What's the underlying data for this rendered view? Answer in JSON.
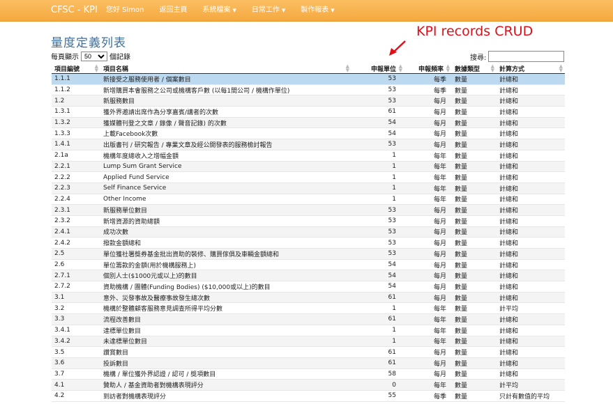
{
  "navbar": {
    "brand": "CFSC - KPI",
    "items": [
      {
        "label": "您好 Simon",
        "caret": false
      },
      {
        "label": "返回主頁",
        "caret": false
      },
      {
        "label": "系統檔案",
        "caret": true
      },
      {
        "label": "日常工作",
        "caret": true
      },
      {
        "label": "製作報表",
        "caret": true
      }
    ]
  },
  "page_title": "量度定義列表",
  "annotation": "KPI records CRUD",
  "length": {
    "before": "每頁顯示",
    "value": "50",
    "after": "個記錄"
  },
  "search": {
    "label": "搜尋:",
    "value": ""
  },
  "columns": [
    "項目編號",
    "項目名稱",
    "申報單位",
    "申報頻率",
    "數據類型",
    "計算方式"
  ],
  "rows": [
    [
      "1.1.1",
      "新接受之服務使用者 / 個案數目",
      "53",
      "每季",
      "數量",
      "計總和"
    ],
    [
      "1.1.2",
      "新增購買本會服務之公司或機構客戶數 (以每1間公司 / 機構作單位)",
      "53",
      "每季",
      "數量",
      "計總和"
    ],
    [
      "1.2",
      "新服務數目",
      "53",
      "每月",
      "數量",
      "計總和"
    ],
    [
      "1.3.1",
      "獲外界邀請出席作為分享嘉賓/講者的次數",
      "61",
      "每月",
      "數量",
      "計總和"
    ],
    [
      "1.3.2",
      "獲媒體刊登之文章 / 錄像 / 聲音記錄) 的次數",
      "54",
      "每月",
      "數量",
      "計總和"
    ],
    [
      "1.3.3",
      "上載Facebook次數",
      "54",
      "每月",
      "數量",
      "計總和"
    ],
    [
      "1.4.1",
      "出版書刊 / 研究報告 / 專業文章及經公開發表的服務檢討報告",
      "53",
      "每月",
      "數量",
      "計總和"
    ],
    [
      "2.1a",
      "機構年度總收入之增幅金額",
      "1",
      "每年",
      "數量",
      "計總和"
    ],
    [
      "2.2.1",
      "Lump Sum Grant Service",
      "1",
      "每年",
      "數量",
      "計總和"
    ],
    [
      "2.2.2",
      "Applied Fund Service",
      "1",
      "每年",
      "數量",
      "計總和"
    ],
    [
      "2.2.3",
      "Self Finance Service",
      "1",
      "每年",
      "數量",
      "計總和"
    ],
    [
      "2.2.4",
      "Other Income",
      "1",
      "每年",
      "數量",
      "計總和"
    ],
    [
      "2.3.1",
      "新服務單位數目",
      "53",
      "每月",
      "數量",
      "計總和"
    ],
    [
      "2.3.2",
      "新增資源的資助總額",
      "53",
      "每月",
      "數量",
      "計總和"
    ],
    [
      "2.4.1",
      "成功次數",
      "53",
      "每月",
      "數量",
      "計總和"
    ],
    [
      "2.4.2",
      "撥款金額總和",
      "53",
      "每月",
      "數量",
      "計總和"
    ],
    [
      "2.5",
      "單位獲社署獎券基金批出資助的裝修、購買傢俱及車輛金額總和",
      "53",
      "每月",
      "數量",
      "計總和"
    ],
    [
      "2.6",
      "單位籌款的金額(用於機構服務上)",
      "54",
      "每月",
      "數量",
      "計總和"
    ],
    [
      "2.7.1",
      "個別人士($1000元或以上)的數目",
      "54",
      "每月",
      "數量",
      "計總和"
    ],
    [
      "2.7.2",
      "資助機構 / 團體(Funding Bodies) ($10,000或以上)的數目",
      "54",
      "每月",
      "數量",
      "計總和"
    ],
    [
      "3.1",
      "意外、災發事故及醫療事故發生總次數",
      "61",
      "每月",
      "數量",
      "計總和"
    ],
    [
      "3.2",
      "機構於整體顧客服務意見調查所得平均分數",
      "1",
      "每年",
      "數量",
      "計平均"
    ],
    [
      "3.3",
      "流程改善數目",
      "61",
      "每年",
      "數量",
      "計總和"
    ],
    [
      "3.4.1",
      "達標單位數目",
      "1",
      "每年",
      "數量",
      "計總和"
    ],
    [
      "3.4.2",
      "未達標單位數目",
      "1",
      "每年",
      "數量",
      "計總和"
    ],
    [
      "3.5",
      "讚賞數目",
      "61",
      "每月",
      "數量",
      "計總和"
    ],
    [
      "3.6",
      "投訴數目",
      "61",
      "每月",
      "數量",
      "計總和"
    ],
    [
      "3.7",
      "機構 / 單位獲外界認證 / 認可 / 獎項數目",
      "58",
      "每月",
      "數量",
      "計總和"
    ],
    [
      "4.1",
      "贊助人 / 基金資助者對機構表現評分",
      "0",
      "每年",
      "數量",
      "計平均"
    ],
    [
      "4.2",
      "到訪者對機構表現評分",
      "55",
      "每季",
      "數量",
      "只計有數值的平均"
    ]
  ]
}
